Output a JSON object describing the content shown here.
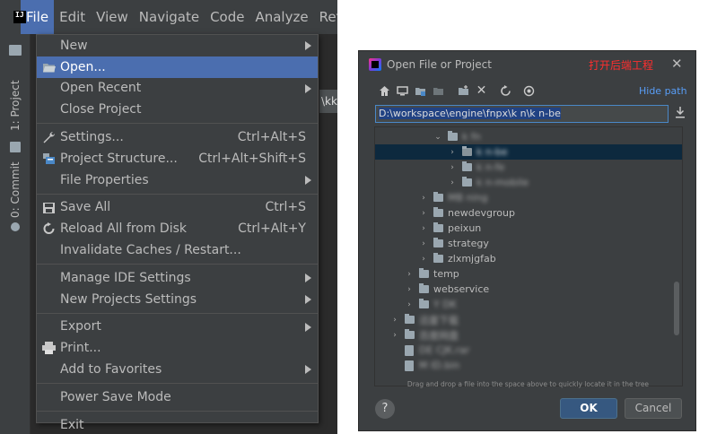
{
  "ide": {
    "menubar": [
      "File",
      "Edit",
      "View",
      "Navigate",
      "Code",
      "Analyze",
      "Ref"
    ],
    "tool_tabs": {
      "project": "1: Project",
      "commit": "0: Commit"
    },
    "editor_tab": "\\kk"
  },
  "file_menu": {
    "items": [
      {
        "label": "New",
        "submenu": true
      },
      {
        "label": "Open...",
        "highlighted": true,
        "icon": "folder-open-icon"
      },
      {
        "label": "Open Recent",
        "submenu": true
      },
      {
        "label": "Close Project"
      },
      {
        "label": "Settings...",
        "shortcut": "Ctrl+Alt+S",
        "icon": "wrench-icon"
      },
      {
        "label": "Project Structure...",
        "shortcut": "Ctrl+Alt+Shift+S",
        "icon": "project-structure-icon"
      },
      {
        "label": "File Properties",
        "submenu": true
      },
      {
        "label": "Save All",
        "shortcut": "Ctrl+S",
        "icon": "save-icon"
      },
      {
        "label": "Reload All from Disk",
        "shortcut": "Ctrl+Alt+Y",
        "icon": "reload-icon"
      },
      {
        "label": "Invalidate Caches / Restart..."
      },
      {
        "label": "Manage IDE Settings",
        "submenu": true
      },
      {
        "label": "New Projects Settings",
        "submenu": true
      },
      {
        "label": "Export",
        "submenu": true
      },
      {
        "label": "Print...",
        "icon": "print-icon"
      },
      {
        "label": "Add to Favorites",
        "submenu": true
      },
      {
        "label": "Power Save Mode"
      },
      {
        "label": "Exit"
      }
    ]
  },
  "dialog": {
    "title": "Open File or Project",
    "annotation": "打开后端工程",
    "hide_path": "Hide path",
    "path_value": "D:\\workspace\\engine\\fnpx\\k  n\\k  n-be",
    "tree": [
      {
        "label": "k  fn",
        "depth": 4,
        "expanded": true
      },
      {
        "label": "k  n-be",
        "depth": 5,
        "selected": true,
        "module": true
      },
      {
        "label": "k  n-fe",
        "depth": 5
      },
      {
        "label": "k  n-mobile",
        "depth": 5
      },
      {
        "label": "MB    ning",
        "depth": 3
      },
      {
        "label": "newdevgroup",
        "depth": 3
      },
      {
        "label": "peixun",
        "depth": 3
      },
      {
        "label": "strategy",
        "depth": 3
      },
      {
        "label": "zlxmjgfab",
        "depth": 3
      },
      {
        "label": "temp",
        "depth": 2
      },
      {
        "label": "webservice",
        "depth": 2
      },
      {
        "label": "Y    DK",
        "depth": 2
      },
      {
        "label": "迅雷下载",
        "depth": 1
      },
      {
        "label": "百度网盘",
        "depth": 1
      },
      {
        "label": "DE       CJK.rar",
        "depth": 1,
        "file": true
      },
      {
        "label": "M    ID.bin",
        "depth": 1,
        "file": true
      }
    ],
    "hint": "Drag and drop a file into the space above to quickly locate it in the tree",
    "help": "?",
    "ok": "OK",
    "cancel": "Cancel"
  }
}
